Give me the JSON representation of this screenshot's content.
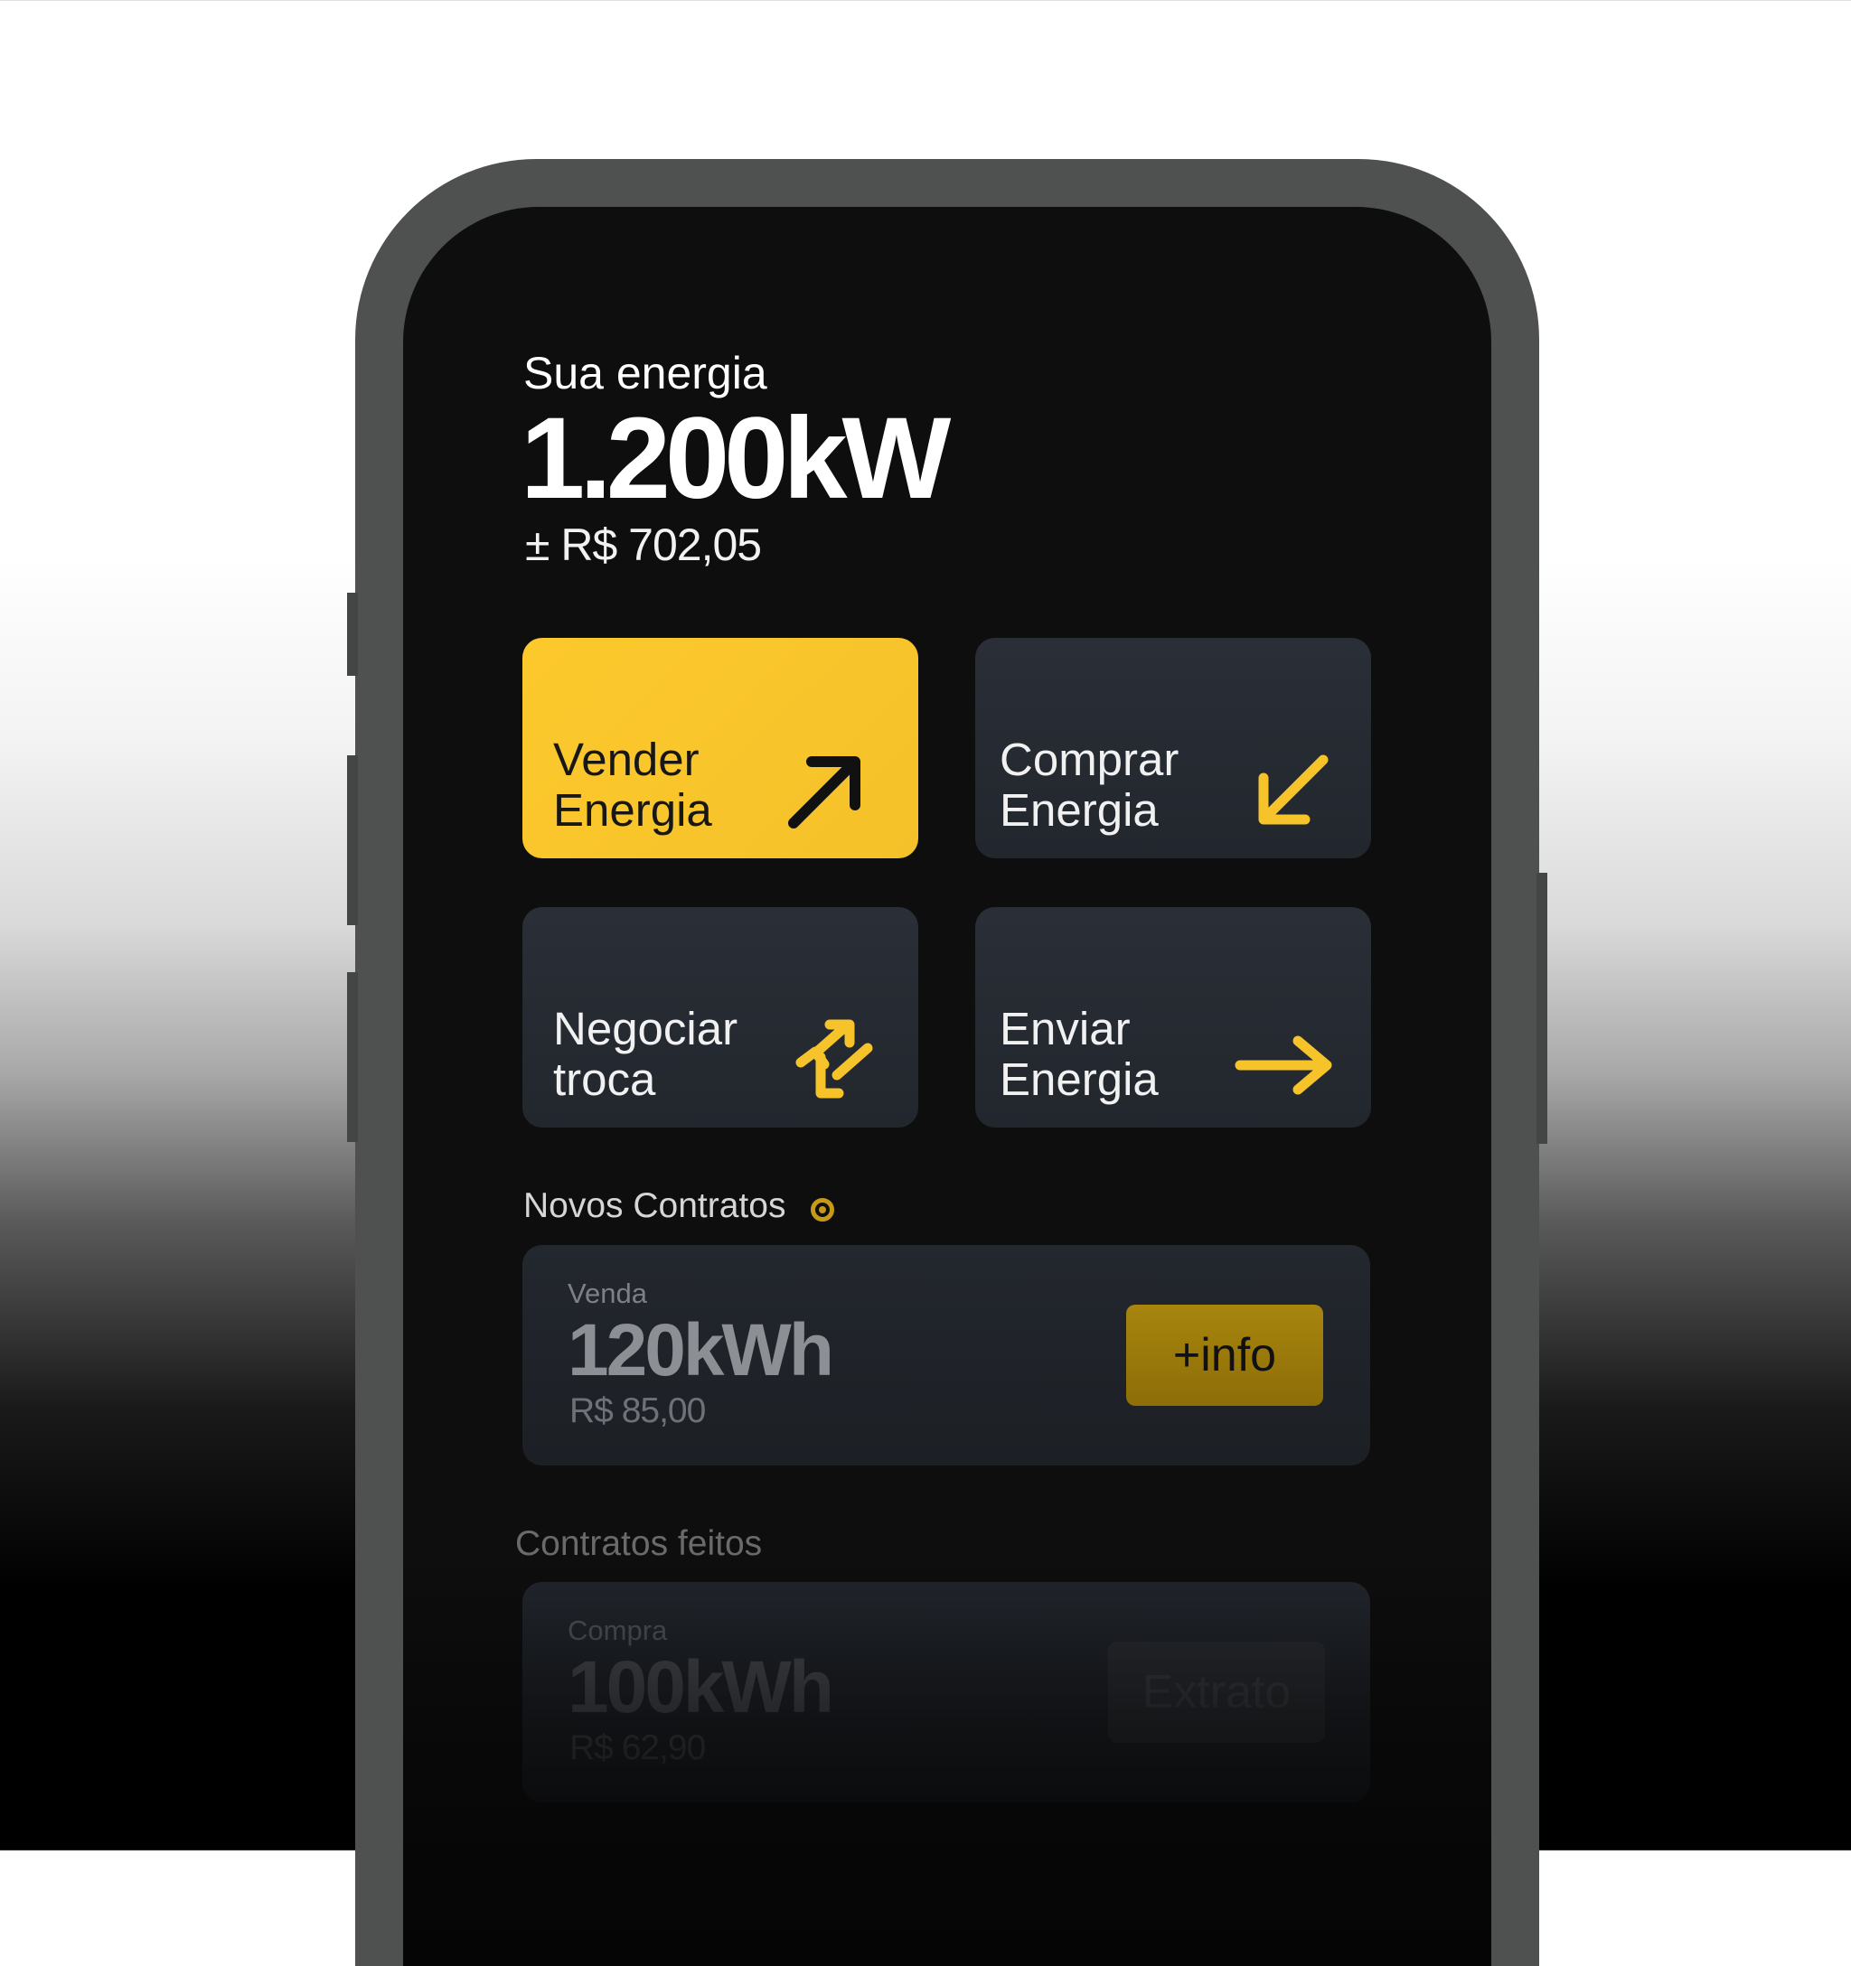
{
  "balance": {
    "title": "Sua energia",
    "value": "1.200kW",
    "money": "± R$ 702,05"
  },
  "actions": [
    {
      "label_line1": "Vender",
      "label_line2": "Energia",
      "icon": "arrow-up-right-icon"
    },
    {
      "label_line1": "Comprar",
      "label_line2": "Energia",
      "icon": "arrow-down-left-icon"
    },
    {
      "label_line1": "Negociar",
      "label_line2": "troca",
      "icon": "swap-arrows-icon"
    },
    {
      "label_line1": "Enviar",
      "label_line2": "Energia",
      "icon": "arrow-right-icon"
    }
  ],
  "new_contracts": {
    "title": "Novos Contratos",
    "item": {
      "type": "Venda",
      "amount": "120kWh",
      "price": "R$ 85,00",
      "button": "+info"
    }
  },
  "done_contracts": {
    "title": "Contratos feitos",
    "item": {
      "type": "Compra",
      "amount": "100kWh",
      "price": "R$ 62,90",
      "button": "Extrato"
    }
  },
  "colors": {
    "accent": "#FCC92C",
    "tile": "#262A31",
    "screen": "#0E0E0E",
    "frame": "#4F5150"
  }
}
